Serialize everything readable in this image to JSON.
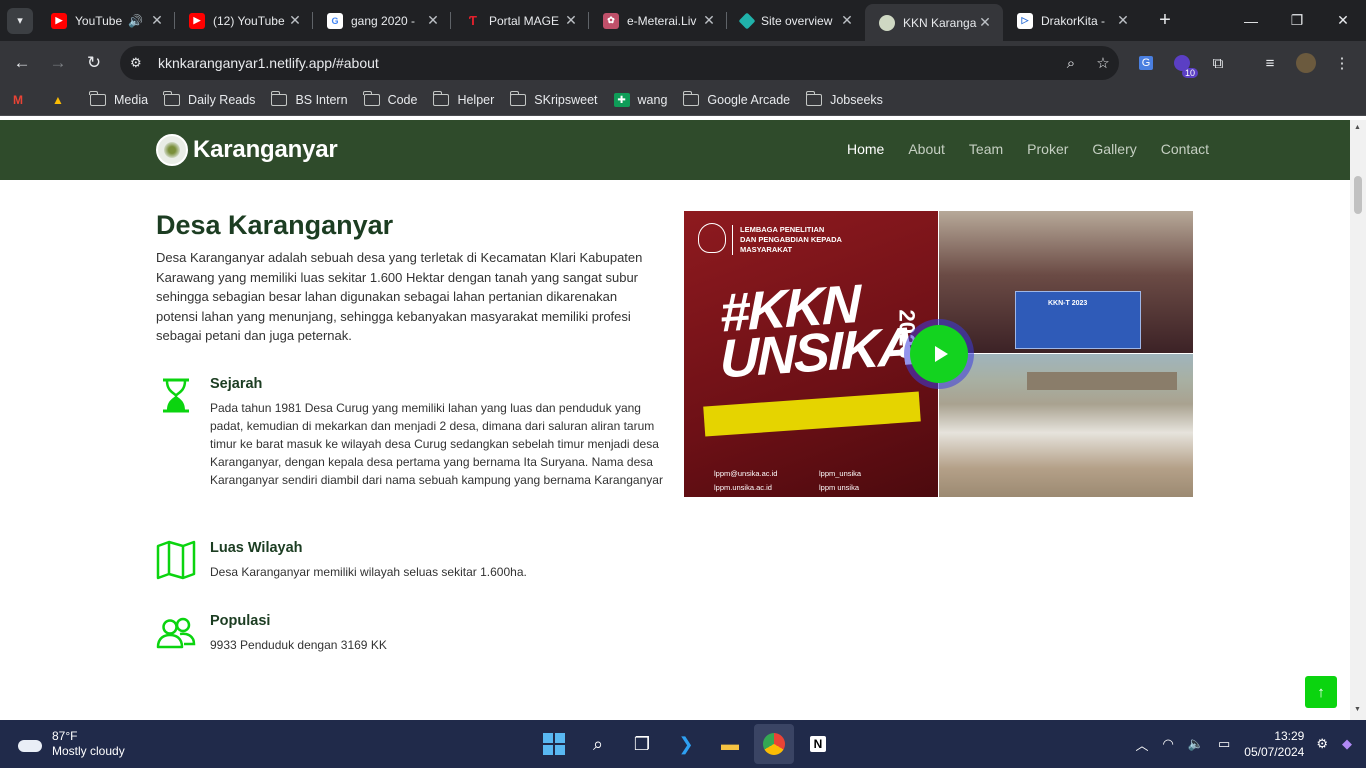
{
  "browser": {
    "tabs": [
      {
        "title": "YouTube",
        "favicon": "youtube-icon",
        "color": "#ff0000",
        "audio": true
      },
      {
        "title": "(12) YouTube",
        "favicon": "youtube-icon",
        "color": "#ff0000"
      },
      {
        "title": "gang 2020 -",
        "favicon": "google-icon",
        "color": "#4285f4"
      },
      {
        "title": "Portal MAGE",
        "favicon": "portal-icon",
        "color": "#e2202c"
      },
      {
        "title": "e-Meterai.Liv",
        "favicon": "emeterai-icon",
        "color": "#c0506a"
      },
      {
        "title": "Site overview",
        "favicon": "netlify-icon",
        "color": "#20b2aa"
      },
      {
        "title": "KKN Karanga",
        "favicon": "site-logo-icon",
        "color": "#cfd8c3",
        "active": true
      },
      {
        "title": "DrakorKita -",
        "favicon": "drakor-icon",
        "color": "#2d6fd6"
      }
    ],
    "url": "kknkaranganyar1.netlify.app/#about",
    "extension_badge": "10",
    "bookmarks": [
      {
        "label": "",
        "icon": "gmail-icon"
      },
      {
        "label": "",
        "icon": "drive-icon"
      },
      {
        "label": "Media",
        "icon": "folder-icon"
      },
      {
        "label": "Daily Reads",
        "icon": "folder-icon"
      },
      {
        "label": "BS Intern",
        "icon": "folder-icon"
      },
      {
        "label": "Code",
        "icon": "folder-icon"
      },
      {
        "label": "Helper",
        "icon": "folder-icon"
      },
      {
        "label": "SKripsweet",
        "icon": "folder-icon"
      },
      {
        "label": "wang",
        "icon": "sheets-icon"
      },
      {
        "label": "Google Arcade",
        "icon": "folder-icon"
      },
      {
        "label": "Jobseeks",
        "icon": "folder-icon"
      }
    ]
  },
  "site": {
    "brand": "Karanganyar",
    "nav": [
      "Home",
      "About",
      "Team",
      "Proker",
      "Gallery",
      "Contact"
    ],
    "nav_active": "Home"
  },
  "about": {
    "title": "Desa Karanganyar",
    "description": "Desa Karanganyar adalah sebuah desa yang terletak di Kecamatan Klari Kabupaten Karawang yang memiliki luas sekitar 1.600 Hektar dengan tanah yang sangat subur sehingga sebagian besar lahan digunakan sebagai lahan pertanian dikarenakan potensi lahan yang menunjang, sehingga kebanyakan masyarakat memiliki profesi sebagai petani dan juga peternak.",
    "features": [
      {
        "title": "Sejarah",
        "icon": "hourglass-icon",
        "text": "Pada tahun 1981 Desa Curug yang memiliki lahan yang luas dan penduduk yang padat, kemudian di mekarkan dan menjadi 2 desa, dimana dari saluran aliran tarum timur ke barat masuk ke wilayah desa Curug sedangkan sebelah timur menjadi desa Karanganyar, dengan kepala desa pertama yang bernama Ita Suryana. Nama desa Karanganyar sendiri diambil dari nama sebuah kampung yang bernama Karanganyar"
      },
      {
        "title": "Luas Wilayah",
        "icon": "map-icon",
        "text": "Desa Karanganyar memiliki wilayah seluas sekitar 1.600ha."
      },
      {
        "title": "Populasi",
        "icon": "people-icon",
        "text": "9933 Penduduk dengan 3169 KK"
      }
    ],
    "poster": {
      "header": "LEMBAGA PENELITIAN DAN PENGABDIAN KEPADA MASYARAKAT",
      "headline": "#KKN UNSIKA",
      "year": "2023",
      "contacts": [
        "lppm@unsika.ac.id",
        "lppm_unsika",
        "lppm.unsika.ac.id",
        "lppm unsika"
      ]
    },
    "photo_banner": "KKN-T 2023"
  },
  "taskbar": {
    "temperature": "87°F",
    "weather": "Mostly cloudy",
    "time": "13:29",
    "date": "05/07/2024"
  },
  "colors": {
    "header_green": "#2f4b2b",
    "accent_green": "#0bd40f",
    "heading": "#1c3d22"
  }
}
